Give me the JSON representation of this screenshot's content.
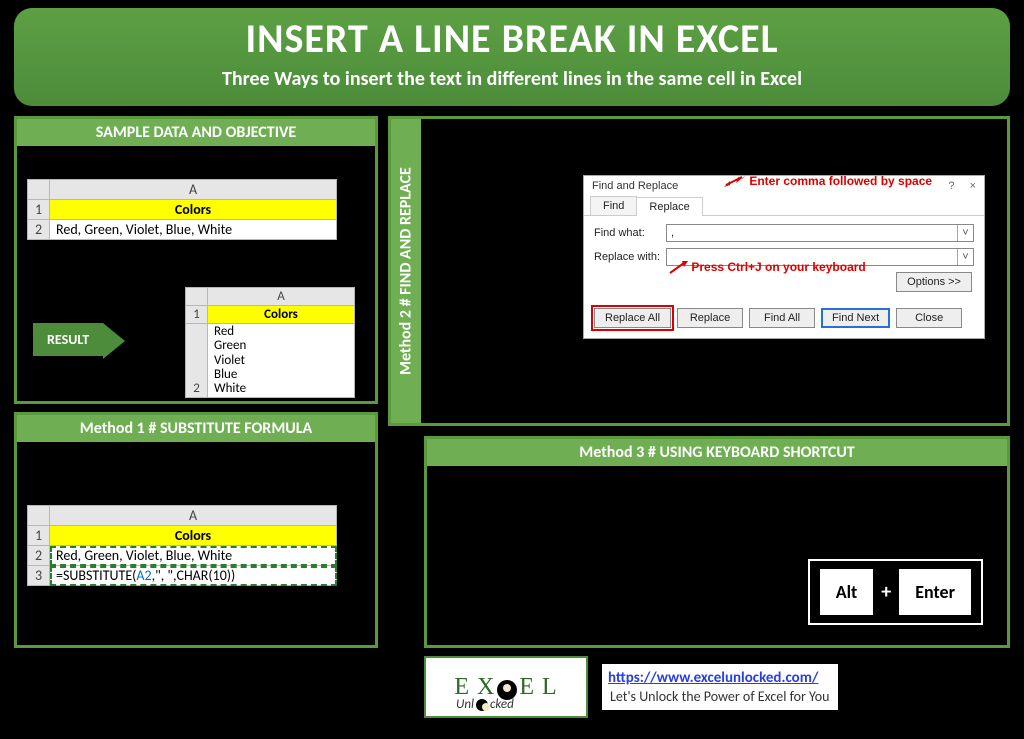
{
  "header": {
    "title": "INSERT A LINE BREAK IN EXCEL",
    "subtitle": "Three Ways to insert the text in different lines in the same cell in Excel"
  },
  "sample": {
    "title": "SAMPLE DATA AND OBJECTIVE",
    "col_a": "A",
    "row1": "1",
    "row2": "2",
    "colors_hdr": "Colors",
    "colors_text": "Red, Green, Violet, Blue, White",
    "result_label": "RESULT",
    "result_col_a": "A",
    "result_row1": "1",
    "result_row2": "2",
    "result_hdr": "Colors",
    "result_lines": "Red\nGreen\nViolet\nBlue\nWhite"
  },
  "method1": {
    "title": "Method 1 # SUBSTITUTE FORMULA",
    "col_a": "A",
    "r1": "1",
    "r2": "2",
    "r3": "3",
    "hdr": "Colors",
    "data": "Red, Green, Violet, Blue, White",
    "formula_pre": "=SUBSTITUTE(",
    "formula_ref": "A2",
    "formula_post": ",\", \",CHAR(10))"
  },
  "method2": {
    "title": "Method 2 # FIND AND REPLACE",
    "dialog_title": "Find and Replace",
    "tab_find": "Find",
    "tab_replace": "Replace",
    "find_label": "Find what:",
    "find_value": ",",
    "replace_label": "Replace with:",
    "options": "Options >>",
    "btn_replace_all": "Replace All",
    "btn_replace": "Replace",
    "btn_find_all": "Find All",
    "btn_find_next": "Find Next",
    "btn_close": "Close",
    "anno_find": "Enter comma followed by space",
    "anno_replace": "Press Ctrl+J on your keyboard",
    "help": "?",
    "close_x": "×"
  },
  "method3": {
    "title": "Method 3 # USING KEYBOARD SHORTCUT",
    "key1": "Alt",
    "plus": "+",
    "key2": "Enter"
  },
  "footer": {
    "logo_main": "E X   E L",
    "logo_sub": "Unl   cked",
    "url": "https://www.excelunlocked.com/",
    "tagline": "Let's Unlock the Power of Excel for You"
  }
}
